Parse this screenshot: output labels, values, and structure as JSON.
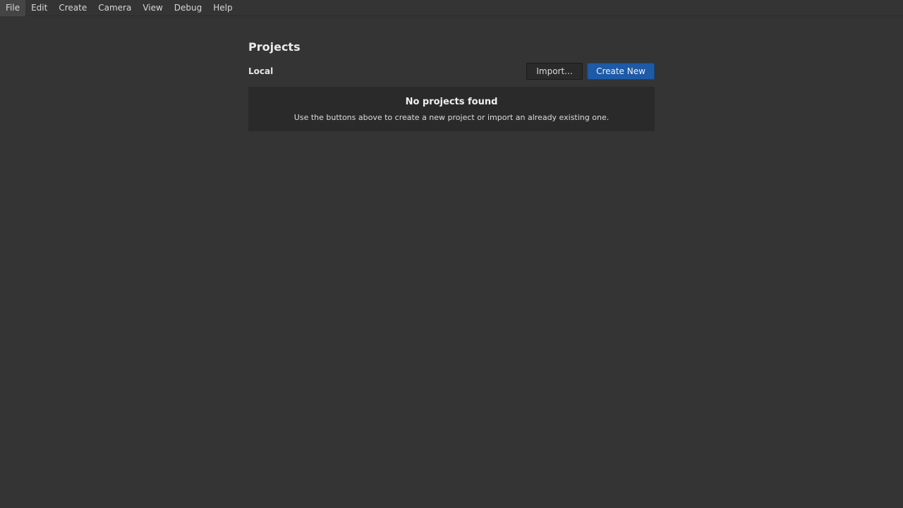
{
  "menubar": {
    "items": [
      {
        "label": "File"
      },
      {
        "label": "Edit"
      },
      {
        "label": "Create"
      },
      {
        "label": "Camera"
      },
      {
        "label": "View"
      },
      {
        "label": "Debug"
      },
      {
        "label": "Help"
      }
    ]
  },
  "projects": {
    "title": "Projects",
    "section_label": "Local",
    "import_label": "Import...",
    "create_label": "Create New",
    "empty_heading": "No projects found",
    "empty_description": "Use the buttons above to create a new project or import an already existing one."
  },
  "colors": {
    "background": "#343434",
    "panel": "#2a2a2a",
    "accent": "#1d5aa8"
  }
}
